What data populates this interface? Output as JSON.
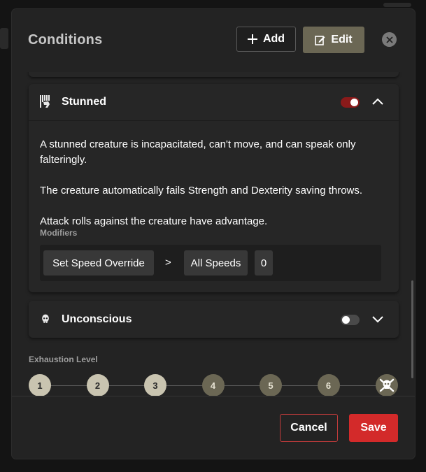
{
  "header": {
    "title": "Conditions",
    "add_label": "Add",
    "edit_label": "Edit"
  },
  "conditions": [
    {
      "name": "Stunned",
      "enabled": true,
      "expanded": true,
      "icon": "stunned-icon",
      "description": [
        "A stunned creature is incapacitated, can't move, and can speak only falteringly.",
        "The creature automatically fails Strength and Dexterity saving throws.",
        "Attack rolls against the creature have advantage."
      ],
      "modifiers_label": "Modifiers",
      "modifier": {
        "type": "Set Speed Override",
        "separator": ">",
        "target": "All Speeds",
        "value": "0"
      }
    },
    {
      "name": "Unconscious",
      "enabled": false,
      "expanded": false,
      "icon": "skull-icon"
    }
  ],
  "exhaustion": {
    "label": "Exhaustion Level",
    "levels": [
      "1",
      "2",
      "3",
      "4",
      "5",
      "6"
    ],
    "filled_levels": 3,
    "final_icon": "skull-crossbones-icon"
  },
  "footer": {
    "cancel_label": "Cancel",
    "save_label": "Save"
  },
  "colors": {
    "accent_red": "#d32a2a",
    "toggle_on": "#8a1a1a",
    "edit_button": "#6b6754",
    "exhaustion_filled": "#c9c4b0"
  }
}
